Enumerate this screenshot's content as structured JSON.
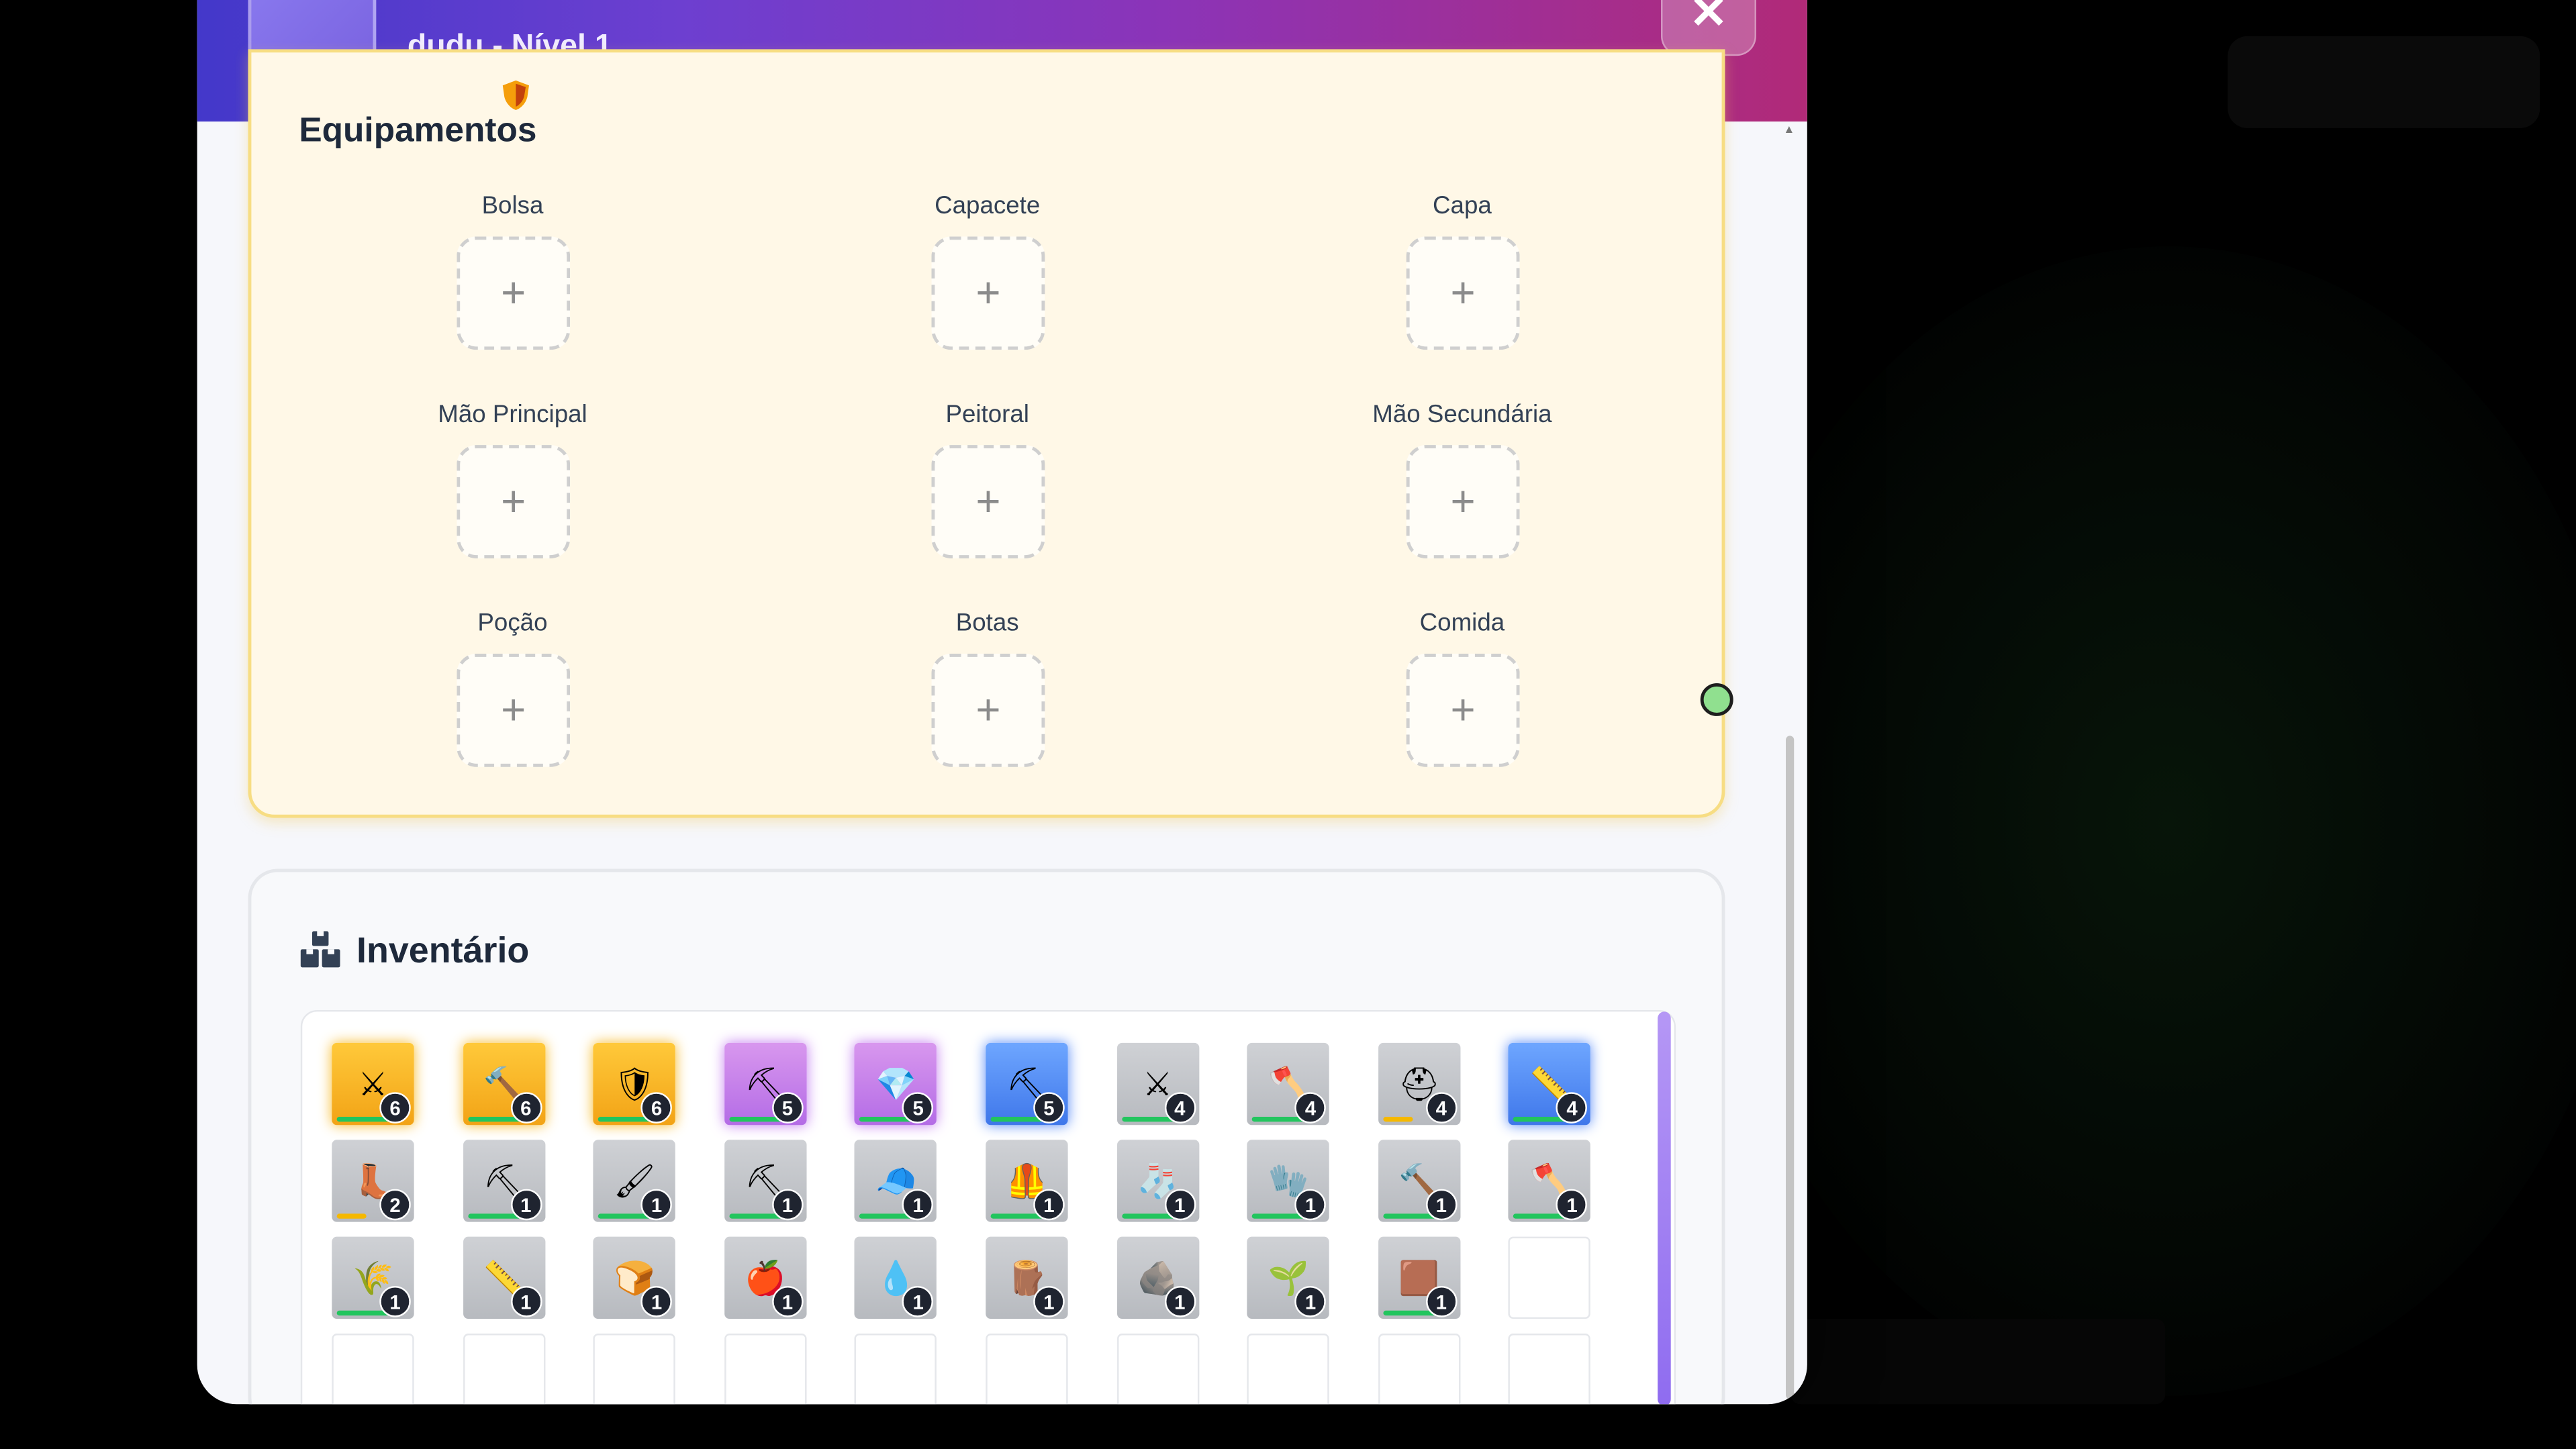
{
  "modal": {
    "title": "Inventário",
    "subtitle": "dudu - Nível 1",
    "close_label": "✕"
  },
  "equipment": {
    "title": "Equipamentos",
    "slot_placeholder": "+",
    "slots": [
      {
        "label": "Bolsa"
      },
      {
        "label": "Capacete"
      },
      {
        "label": "Capa"
      },
      {
        "label": "Mão Principal"
      },
      {
        "label": "Peitoral"
      },
      {
        "label": "Mão Secundária"
      },
      {
        "label": "Poção"
      },
      {
        "label": "Botas"
      },
      {
        "label": "Comida"
      }
    ]
  },
  "inventory": {
    "title": "Inventário",
    "items": [
      {
        "icon": "swords-icon",
        "glyph": "⚔",
        "rarity": "legend",
        "count": "6",
        "durability": 0.8
      },
      {
        "icon": "hammer-icon",
        "glyph": "🔨",
        "rarity": "legend",
        "count": "6",
        "durability": 0.8
      },
      {
        "icon": "shield-icon",
        "glyph": "🛡",
        "rarity": "legend",
        "count": "6",
        "durability": 0.8
      },
      {
        "icon": "pickaxe-icon",
        "glyph": "⛏",
        "rarity": "epic",
        "count": "5",
        "durability": 0.8
      },
      {
        "icon": "gem-icon",
        "glyph": "💎",
        "rarity": "epic",
        "count": "5",
        "durability": 0.8
      },
      {
        "icon": "pickaxe-icon",
        "glyph": "⛏",
        "rarity": "rare",
        "count": "5",
        "durability": 0.8
      },
      {
        "icon": "swords-icon",
        "glyph": "⚔",
        "rarity": "common",
        "count": "4",
        "durability": 0.8
      },
      {
        "icon": "axe-icon",
        "glyph": "🪓",
        "rarity": "common",
        "count": "4",
        "durability": 0.8
      },
      {
        "icon": "helmet-icon",
        "glyph": "⛑",
        "rarity": "common",
        "count": "4",
        "durability": 0.4
      },
      {
        "icon": "ruler-icon",
        "glyph": "📏",
        "rarity": "rare",
        "count": "4",
        "durability": 0.8
      },
      {
        "icon": "boot-icon",
        "glyph": "👢",
        "rarity": "common",
        "count": "2",
        "durability": 0.4
      },
      {
        "icon": "pickaxe-icon",
        "glyph": "⛏",
        "rarity": "common",
        "count": "1",
        "durability": 0.8
      },
      {
        "icon": "brush-icon",
        "glyph": "🖌",
        "rarity": "common",
        "count": "1",
        "durability": 0.8
      },
      {
        "icon": "pickaxe-icon",
        "glyph": "⛏",
        "rarity": "common",
        "count": "1",
        "durability": 0.8
      },
      {
        "icon": "cap-icon",
        "glyph": "🧢",
        "rarity": "common",
        "count": "1",
        "durability": 0.8
      },
      {
        "icon": "vest-icon",
        "glyph": "🦺",
        "rarity": "common",
        "count": "1",
        "durability": 0.8
      },
      {
        "icon": "sock-icon",
        "glyph": "🧦",
        "rarity": "common",
        "count": "1",
        "durability": 0.8
      },
      {
        "icon": "glove-icon",
        "glyph": "🧤",
        "rarity": "common",
        "count": "1",
        "durability": 0.8
      },
      {
        "icon": "hammer-icon",
        "glyph": "🔨",
        "rarity": "common",
        "count": "1",
        "durability": 0.8
      },
      {
        "icon": "axe-icon",
        "glyph": "🪓",
        "rarity": "common",
        "count": "1",
        "durability": 0.8
      },
      {
        "icon": "wheat-icon",
        "glyph": "🌾",
        "rarity": "common",
        "count": "1",
        "durability": 0.8
      },
      {
        "icon": "ruler-icon",
        "glyph": "📏",
        "rarity": "common",
        "count": "1",
        "durability": 0
      },
      {
        "icon": "bread-icon",
        "glyph": "🍞",
        "rarity": "common",
        "count": "1",
        "durability": 0
      },
      {
        "icon": "apple-icon",
        "glyph": "🍎",
        "rarity": "common",
        "count": "1",
        "durability": 0
      },
      {
        "icon": "water-drop-icon",
        "glyph": "💧",
        "rarity": "common",
        "count": "1",
        "durability": 0
      },
      {
        "icon": "log-icon",
        "glyph": "🪵",
        "rarity": "common",
        "count": "1",
        "durability": 0
      },
      {
        "icon": "stone-icon",
        "glyph": "🪨",
        "rarity": "common",
        "count": "1",
        "durability": 0
      },
      {
        "icon": "sapling-icon",
        "glyph": "🌱",
        "rarity": "common",
        "count": "1",
        "durability": 0
      },
      {
        "icon": "dirt-icon",
        "glyph": "🟫",
        "rarity": "common",
        "count": "1",
        "durability": 0.8
      },
      {
        "icon": "",
        "glyph": "",
        "rarity": "empty",
        "count": "",
        "durability": 0
      },
      {
        "icon": "",
        "glyph": "",
        "rarity": "empty",
        "count": "",
        "durability": 0
      },
      {
        "icon": "",
        "glyph": "",
        "rarity": "empty",
        "count": "",
        "durability": 0
      },
      {
        "icon": "",
        "glyph": "",
        "rarity": "empty",
        "count": "",
        "durability": 0
      },
      {
        "icon": "",
        "glyph": "",
        "rarity": "empty",
        "count": "",
        "durability": 0
      },
      {
        "icon": "",
        "glyph": "",
        "rarity": "empty",
        "count": "",
        "durability": 0
      },
      {
        "icon": "",
        "glyph": "",
        "rarity": "empty",
        "count": "",
        "durability": 0
      },
      {
        "icon": "",
        "glyph": "",
        "rarity": "empty",
        "count": "",
        "durability": 0
      },
      {
        "icon": "",
        "glyph": "",
        "rarity": "empty",
        "count": "",
        "durability": 0
      },
      {
        "icon": "",
        "glyph": "",
        "rarity": "empty",
        "count": "",
        "durability": 0
      },
      {
        "icon": "",
        "glyph": "",
        "rarity": "empty",
        "count": "",
        "durability": 0
      }
    ]
  },
  "colors": {
    "header_start": "#4338ca",
    "header_end": "#b12a78",
    "equip_bg": "#fff8e7",
    "equip_border": "#f7dd83",
    "durability_good": "#22c55e",
    "durability_low": "#f5b800"
  }
}
